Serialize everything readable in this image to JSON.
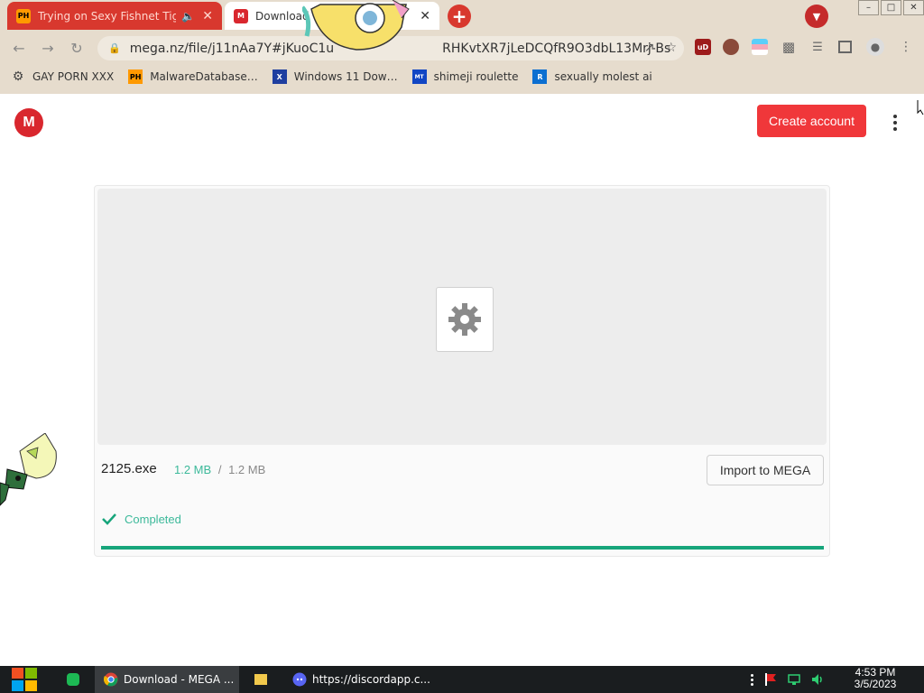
{
  "browser": {
    "tabs": [
      {
        "title": "Trying on Sexy Fishnet Tig",
        "favicon": "PH",
        "icons": [
          "speaker-muted-icon",
          "close-icon"
        ]
      },
      {
        "title": "Download",
        "favicon": "M",
        "icons": [
          "close-icon"
        ]
      }
    ],
    "new_tab": "+",
    "address": "mega.nz/file/j11nAa7Y#jKuoC1u",
    "address_tail": "RHKvtXR7jLeDCQfR9O3dbL13Mrj-Bs",
    "bookmarks": [
      {
        "label": "GAY PORN XXX",
        "icon": "gear-icon"
      },
      {
        "label": "MalwareDatabase…",
        "icon": "PH"
      },
      {
        "label": "Windows 11 Dow…",
        "icon": "X"
      },
      {
        "label": "shimeji roulette",
        "icon": "MT"
      },
      {
        "label": "sexually molest ai",
        "icon": "R"
      }
    ],
    "extension_ub": "uD",
    "winbtn_min": "–",
    "winbtn_max": "□",
    "winbtn_close": "✕"
  },
  "mega": {
    "logo": "M",
    "create_account": "Create account",
    "file_name": "2125.exe",
    "downloaded": "1.2 MB",
    "separator": "/",
    "total": "1.2 MB",
    "import_label": "Import to MEGA",
    "status": "Completed",
    "progress": 1.0,
    "accent": "#f0373a",
    "success": "#17a57b"
  },
  "taskbar": {
    "items": [
      {
        "label": "Download - MEGA ...",
        "icon": "chrome-icon"
      },
      {
        "label": "https://discordapp.c...",
        "icon": "discord-icon"
      }
    ],
    "time": "4:53 PM",
    "date": "3/5/2023"
  }
}
